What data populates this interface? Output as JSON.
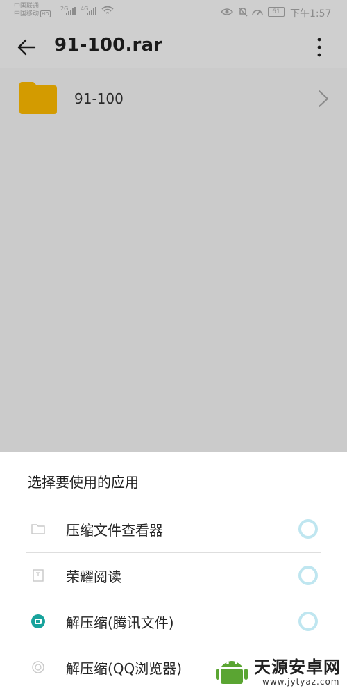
{
  "status_bar": {
    "carrier_1": "中国联通",
    "carrier_2": "中国移动",
    "hd_badge": "HD",
    "network_1": "2G",
    "network_2": "4G",
    "battery": "61",
    "time": "下午1:57"
  },
  "app_bar": {
    "title": "91-100.rar"
  },
  "list": {
    "items": [
      {
        "label": "91-100"
      }
    ]
  },
  "sheet": {
    "title": "选择要使用的应用",
    "apps": [
      {
        "label": "压缩文件查看器",
        "icon": "folder-outline-icon"
      },
      {
        "label": "荣耀阅读",
        "icon": "book-icon"
      },
      {
        "label": "解压缩(腾讯文件)",
        "icon": "tencent-files-icon"
      },
      {
        "label": "解压缩(QQ浏览器)",
        "icon": "qq-browser-icon"
      }
    ]
  },
  "watermark": {
    "text": "天源安卓网",
    "url": "www.jytyaz.com",
    "icon": "android-logo-icon"
  },
  "colors": {
    "folder": "#d39b00",
    "radio_ring": "#bfe6f0",
    "tencent_icon": "#18a39c"
  }
}
